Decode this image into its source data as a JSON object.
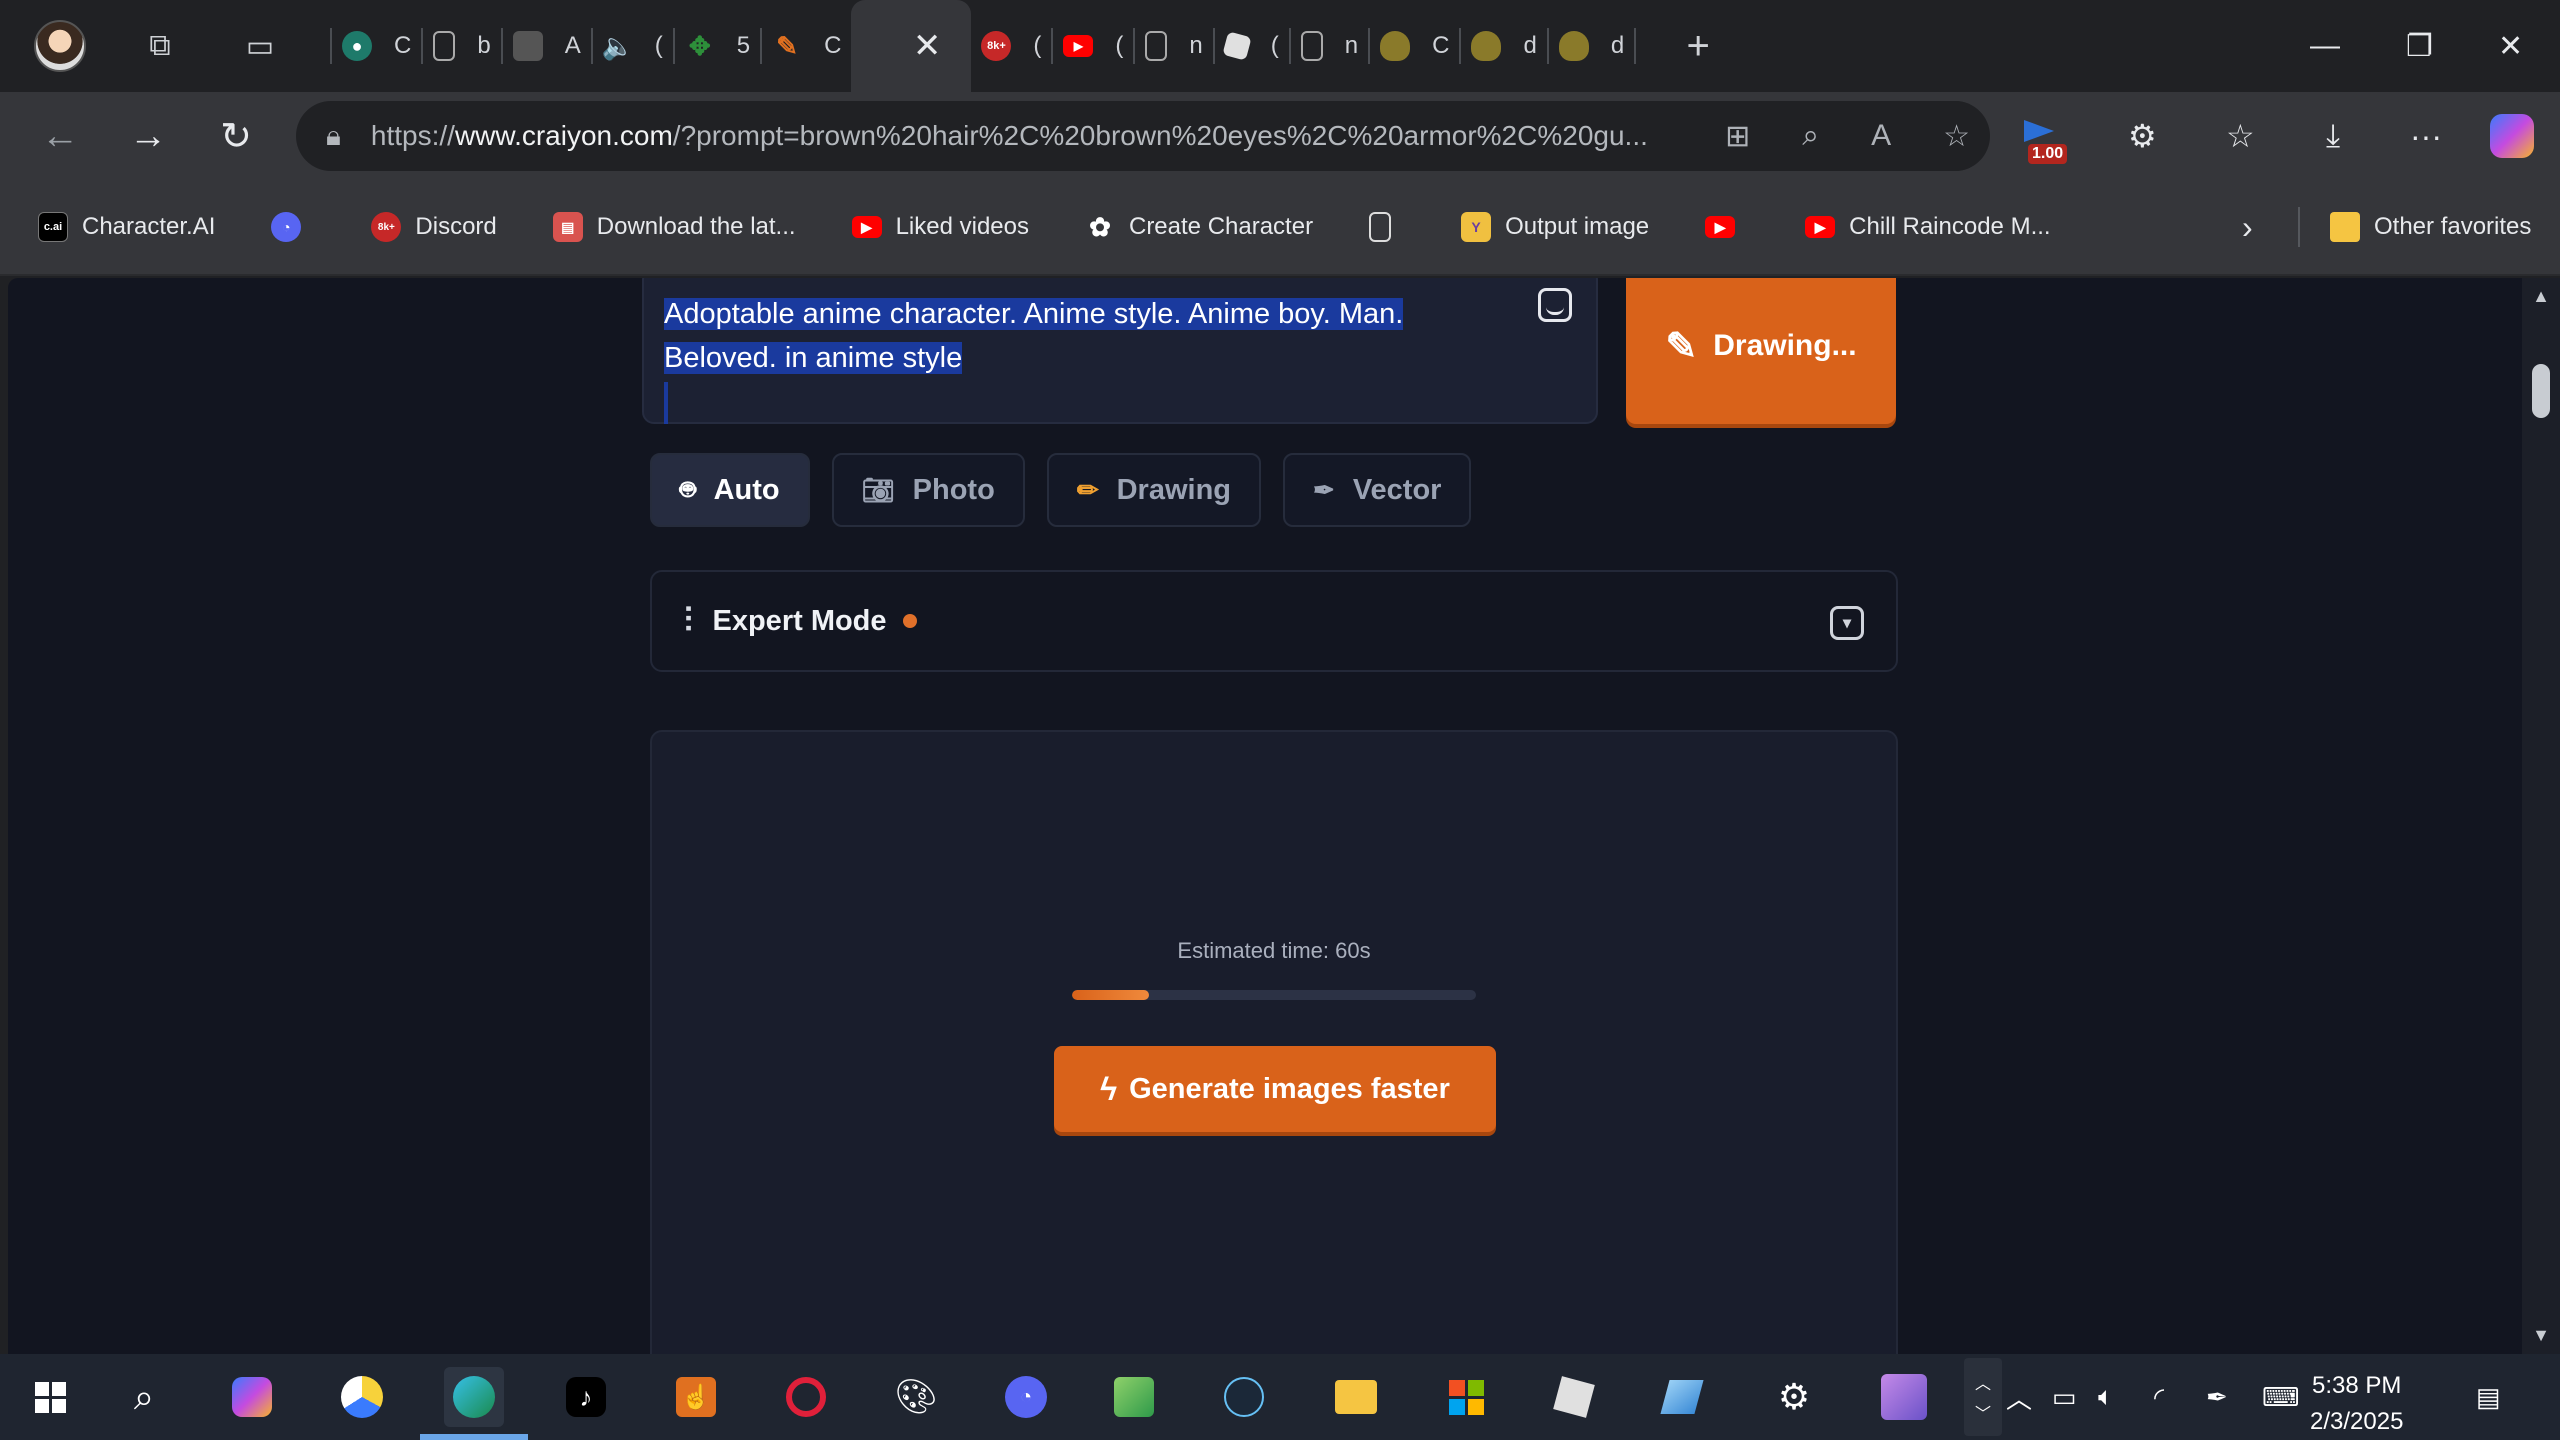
{
  "browser": {
    "tabs": [
      {
        "label": "C",
        "icon": "globe-icon",
        "color": "#1e7a6a"
      },
      {
        "label": "b",
        "icon": "page-icon",
        "color": ""
      },
      {
        "label": "A",
        "icon": "image-icon",
        "color": "#555555"
      },
      {
        "label": "(",
        "icon": "speaker-icon",
        "color": ""
      },
      {
        "label": "5",
        "icon": "pinwheel-icon",
        "color": "#2d8f3a"
      },
      {
        "label": "C",
        "icon": "pencil-icon",
        "color": "#e07020"
      },
      {
        "label": "(",
        "icon": "8k-icon",
        "color": "#c62828"
      },
      {
        "label": "(",
        "icon": "youtube-icon",
        "color": "#ff0000"
      },
      {
        "label": "n",
        "icon": "page-icon",
        "color": ""
      },
      {
        "label": "(",
        "icon": "roblox-icon",
        "color": "#e0e0e0"
      },
      {
        "label": "n",
        "icon": "page-icon",
        "color": ""
      },
      {
        "label": "C",
        "icon": "blob-icon",
        "color": "#8a7a2a"
      },
      {
        "label": "d",
        "icon": "blob-icon",
        "color": "#8a7a2a"
      },
      {
        "label": "d",
        "icon": "blob-icon",
        "color": "#8a7a2a"
      }
    ],
    "active_tab_close": "✕",
    "url_prefix": "https://",
    "url_domain": "www.craiyon.com",
    "url_rest": "/?prompt=brown%20hair%2C%20brown%20eyes%2C%20armor%2C%20gu...",
    "ext_badge": "1.00",
    "bookmarks": [
      {
        "label": "Character.AI",
        "icon": "cai-icon",
        "color": "#000000"
      },
      {
        "label": "",
        "icon": "discord-icon",
        "color": "#5865f2"
      },
      {
        "label": "Discord",
        "icon": "8k-icon",
        "color": "#c62828"
      },
      {
        "label": "Download the lat...",
        "icon": "store-icon",
        "color": "#d9534f"
      },
      {
        "label": "Liked videos",
        "icon": "youtube-icon",
        "color": "#ff0000"
      },
      {
        "label": "Create Character",
        "icon": "openai-icon",
        "color": "#ffffff"
      },
      {
        "label": "",
        "icon": "page-icon",
        "color": ""
      },
      {
        "label": "Output image",
        "icon": "y-icon",
        "color": "#f0c040"
      },
      {
        "label": "",
        "icon": "youtube-icon",
        "color": "#ff0000"
      },
      {
        "label": "Chill Raincode M...",
        "icon": "youtube-icon",
        "color": "#ff0000"
      }
    ],
    "other_favorites": "Other favorites"
  },
  "page": {
    "prompt_line1": "Adoptable anime character. Anime style. Anime boy. Man.",
    "prompt_line2": "Beloved. in anime style",
    "draw_button": "Drawing...",
    "modes": [
      {
        "label": "Auto",
        "icon": "robot-icon",
        "active": true
      },
      {
        "label": "Photo",
        "icon": "camera-icon",
        "active": false
      },
      {
        "label": "Drawing",
        "icon": "pencil-icon",
        "active": false
      },
      {
        "label": "Vector",
        "icon": "pen-nib-icon",
        "active": false
      }
    ],
    "expert_mode": "Expert Mode",
    "estimated_time": "Estimated time: 60s",
    "progress": 0.19,
    "faster_button": "Generate images faster",
    "accent": "#d9621a"
  },
  "taskbar": {
    "time": "5:38 PM",
    "date": "2/3/2025"
  }
}
